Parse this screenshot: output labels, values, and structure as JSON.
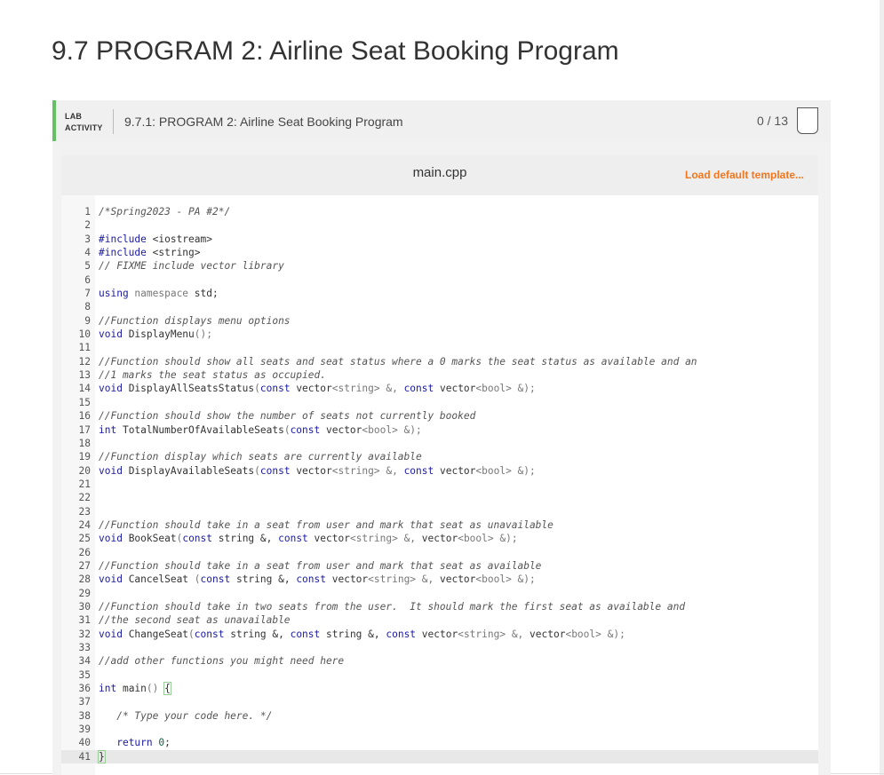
{
  "page": {
    "title": "9.7 PROGRAM 2: Airline Seat Booking Program"
  },
  "activity": {
    "type_line1": "LAB",
    "type_line2": "ACTIVITY",
    "title": "9.7.1: PROGRAM 2: Airline Seat Booking Program",
    "score": "0 / 13"
  },
  "editor": {
    "filename": "main.cpp",
    "load_template_label": "Load default template...",
    "lines": [
      [
        {
          "t": "/*Spring2023 - PA #2*/",
          "s": "c"
        }
      ],
      [],
      [
        {
          "t": "#include ",
          "s": "k"
        },
        {
          "t": "<iostream>",
          "s": ""
        }
      ],
      [
        {
          "t": "#include ",
          "s": "k"
        },
        {
          "t": "<string>",
          "s": ""
        }
      ],
      [
        {
          "t": "// FIXME include vector library",
          "s": "c"
        }
      ],
      [],
      [
        {
          "t": "using",
          "s": "k"
        },
        {
          "t": " namespace ",
          "s": "op"
        },
        {
          "t": "std;",
          "s": ""
        }
      ],
      [],
      [
        {
          "t": "//Function displays menu options",
          "s": "c"
        }
      ],
      [
        {
          "t": "void ",
          "s": "k"
        },
        {
          "t": "DisplayMenu",
          "s": ""
        },
        {
          "t": "();",
          "s": "op"
        }
      ],
      [],
      [
        {
          "t": "//Function should show all seats and seat status where a 0 marks the seat status as available and an",
          "s": "c"
        }
      ],
      [
        {
          "t": "//1 marks the seat status as occupied.",
          "s": "c"
        }
      ],
      [
        {
          "t": "void ",
          "s": "k"
        },
        {
          "t": "DisplayAllSeatsStatus",
          "s": ""
        },
        {
          "t": "(",
          "s": "op"
        },
        {
          "t": "const ",
          "s": "k"
        },
        {
          "t": "vector",
          "s": ""
        },
        {
          "t": "<string> &, ",
          "s": "op"
        },
        {
          "t": "const ",
          "s": "k"
        },
        {
          "t": "vector",
          "s": ""
        },
        {
          "t": "<bool> &);",
          "s": "op"
        }
      ],
      [],
      [
        {
          "t": "//Function should show the number of seats not currently booked",
          "s": "c"
        }
      ],
      [
        {
          "t": "int ",
          "s": "k"
        },
        {
          "t": "TotalNumberOfAvailableSeats",
          "s": ""
        },
        {
          "t": "(",
          "s": "op"
        },
        {
          "t": "const ",
          "s": "k"
        },
        {
          "t": "vector",
          "s": ""
        },
        {
          "t": "<bool> &);",
          "s": "op"
        }
      ],
      [],
      [
        {
          "t": "//Function display which seats are currently available",
          "s": "c"
        }
      ],
      [
        {
          "t": "void ",
          "s": "k"
        },
        {
          "t": "DisplayAvailableSeats",
          "s": ""
        },
        {
          "t": "(",
          "s": "op"
        },
        {
          "t": "const ",
          "s": "k"
        },
        {
          "t": "vector",
          "s": ""
        },
        {
          "t": "<string> &, ",
          "s": "op"
        },
        {
          "t": "const ",
          "s": "k"
        },
        {
          "t": "vector",
          "s": ""
        },
        {
          "t": "<bool> &);",
          "s": "op"
        }
      ],
      [],
      [],
      [],
      [
        {
          "t": "//Function should take in a seat from user and mark that seat as unavailable",
          "s": "c"
        }
      ],
      [
        {
          "t": "void ",
          "s": "k"
        },
        {
          "t": "BookSeat",
          "s": ""
        },
        {
          "t": "(",
          "s": "op"
        },
        {
          "t": "const ",
          "s": "k"
        },
        {
          "t": "string &, ",
          "s": ""
        },
        {
          "t": "const ",
          "s": "k"
        },
        {
          "t": "vector",
          "s": ""
        },
        {
          "t": "<string> &, ",
          "s": "op"
        },
        {
          "t": "vector",
          "s": ""
        },
        {
          "t": "<bool> &);",
          "s": "op"
        }
      ],
      [],
      [
        {
          "t": "//Function should take in a seat from user and mark that seat as available",
          "s": "c"
        }
      ],
      [
        {
          "t": "void ",
          "s": "k"
        },
        {
          "t": "CancelSeat ",
          "s": ""
        },
        {
          "t": "(",
          "s": "op"
        },
        {
          "t": "const ",
          "s": "k"
        },
        {
          "t": "string &, ",
          "s": ""
        },
        {
          "t": "const ",
          "s": "k"
        },
        {
          "t": "vector",
          "s": ""
        },
        {
          "t": "<string> &, ",
          "s": "op"
        },
        {
          "t": "vector",
          "s": ""
        },
        {
          "t": "<bool> &);",
          "s": "op"
        }
      ],
      [],
      [
        {
          "t": "//Function should take in two seats from the user.  It should mark the first seat as available and",
          "s": "c"
        }
      ],
      [
        {
          "t": "//the second seat as unavailable",
          "s": "c"
        }
      ],
      [
        {
          "t": "void ",
          "s": "k"
        },
        {
          "t": "ChangeSeat",
          "s": ""
        },
        {
          "t": "(",
          "s": "op"
        },
        {
          "t": "const ",
          "s": "k"
        },
        {
          "t": "string &, ",
          "s": ""
        },
        {
          "t": "const ",
          "s": "k"
        },
        {
          "t": "string &, ",
          "s": ""
        },
        {
          "t": "const ",
          "s": "k"
        },
        {
          "t": "vector",
          "s": ""
        },
        {
          "t": "<string> &, ",
          "s": "op"
        },
        {
          "t": "vector",
          "s": ""
        },
        {
          "t": "<bool> &);",
          "s": "op"
        }
      ],
      [],
      [
        {
          "t": "//add other functions you might need here",
          "s": "c"
        }
      ],
      [],
      [
        {
          "t": "int ",
          "s": "k"
        },
        {
          "t": "main",
          "s": ""
        },
        {
          "t": "() ",
          "s": "op"
        },
        {
          "t": "{",
          "s": "bm"
        }
      ],
      [],
      [
        {
          "t": "   /* Type your code here. */",
          "s": "c"
        }
      ],
      [],
      [
        {
          "t": "   ",
          "s": ""
        },
        {
          "t": "return ",
          "s": "k"
        },
        {
          "t": "0",
          "s": "n"
        },
        {
          "t": ";",
          "s": ""
        }
      ],
      [
        {
          "t": "}",
          "s": "bm"
        }
      ]
    ],
    "active_line": 41
  }
}
